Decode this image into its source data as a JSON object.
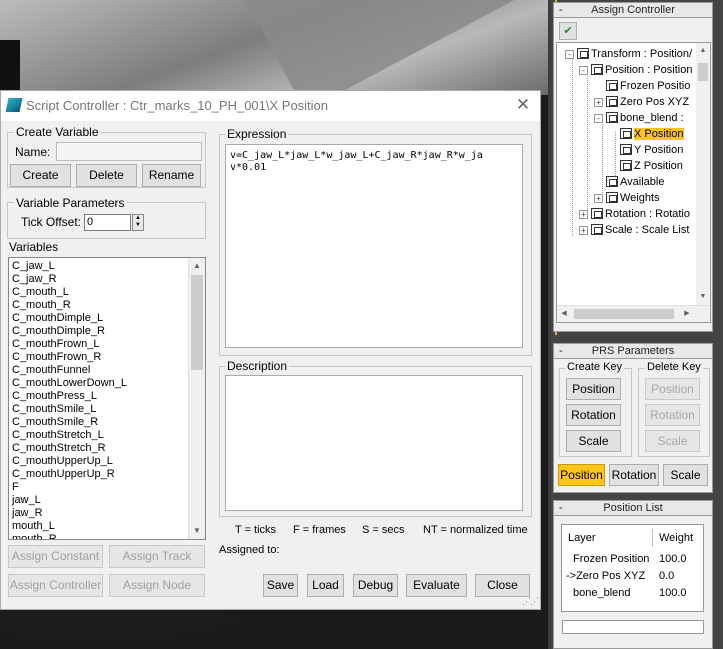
{
  "dialog": {
    "title": "Script Controller : Ctr_marks_10_PH_001\\X Position",
    "close": "✕"
  },
  "create_variable": {
    "group_label": "Create Variable",
    "name_label": "Name:",
    "name_value": "",
    "create": "Create",
    "delete": "Delete",
    "rename": "Rename"
  },
  "variable_parameters": {
    "group_label": "Variable Parameters",
    "tick_offset_label": "Tick Offset:",
    "tick_offset_value": "0"
  },
  "variables": {
    "label": "Variables",
    "items": [
      "C_jaw_L",
      "C_jaw_R",
      "C_mouth_L",
      "C_mouth_R",
      "C_mouthDimple_L",
      "C_mouthDimple_R",
      "C_mouthFrown_L",
      "C_mouthFrown_R",
      "C_mouthFunnel",
      "C_mouthLowerDown_L",
      "C_mouthPress_L",
      "C_mouthSmile_L",
      "C_mouthSmile_R",
      "C_mouthStretch_L",
      "C_mouthStretch_R",
      "C_mouthUpperUp_L",
      "C_mouthUpperUp_R",
      "F",
      "jaw_L",
      "jaw_R",
      "mouth_L",
      "mouth_R"
    ]
  },
  "assign_buttons": {
    "assign_constant": "Assign Constant",
    "assign_track": "Assign Track",
    "assign_controller": "Assign Controller",
    "assign_node": "Assign Node"
  },
  "expression": {
    "label": "Expression",
    "text": "v=C_jaw_L*jaw_L*w_jaw_L+C_jaw_R*jaw_R*w_ja\nv*0.01"
  },
  "description": {
    "label": "Description",
    "text": ""
  },
  "legend": {
    "ticks": "T = ticks",
    "frames": "F = frames",
    "secs": "S = secs",
    "normalized": "NT = normalized time"
  },
  "assigned_to": "Assigned to:",
  "bottom_buttons": {
    "save": "Save",
    "load": "Load",
    "debug": "Debug",
    "evaluate": "Evaluate",
    "close": "Close"
  },
  "assign_controller_panel": {
    "title": "Assign Controller",
    "minus": "-",
    "tree": [
      {
        "label": "Transform : Position/",
        "pm": "-"
      },
      {
        "label": "Position : Position",
        "pm": "-"
      },
      {
        "label": "Frozen Positio",
        "pm": ""
      },
      {
        "label": "Zero Pos XYZ",
        "pm": "+"
      },
      {
        "label": "bone_blend :",
        "pm": "-"
      },
      {
        "label": "X Position",
        "pm": ""
      },
      {
        "label": "Y Position",
        "pm": ""
      },
      {
        "label": "Z Position",
        "pm": ""
      },
      {
        "label": "Available",
        "pm": ""
      },
      {
        "label": "Weights",
        "pm": "+"
      },
      {
        "label": "Rotation : Rotatio",
        "pm": "+"
      },
      {
        "label": "Scale : Scale List",
        "pm": "+"
      }
    ]
  },
  "prs_parameters": {
    "title": "PRS Parameters",
    "minus": "-",
    "create_key_label": "Create Key",
    "delete_key_label": "Delete Key",
    "create_position": "Position",
    "create_rotation": "Rotation",
    "create_scale": "Scale",
    "delete_position": "Position",
    "delete_rotation": "Rotation",
    "delete_scale": "Scale",
    "tab_position": "Position",
    "tab_rotation": "Rotation",
    "tab_scale": "Scale"
  },
  "position_list": {
    "title": "Position List",
    "minus": "-",
    "header_layer": "Layer",
    "header_weight": "Weight",
    "rows": [
      {
        "layer": "Frozen Position",
        "weight": "100.0"
      },
      {
        "layer": "->Zero Pos XYZ",
        "weight": "0.0"
      },
      {
        "layer": "bone_blend",
        "weight": "100.0"
      }
    ]
  },
  "colors": {
    "selected": "#ffc51a",
    "panel_bg": "#f0f0f0"
  }
}
